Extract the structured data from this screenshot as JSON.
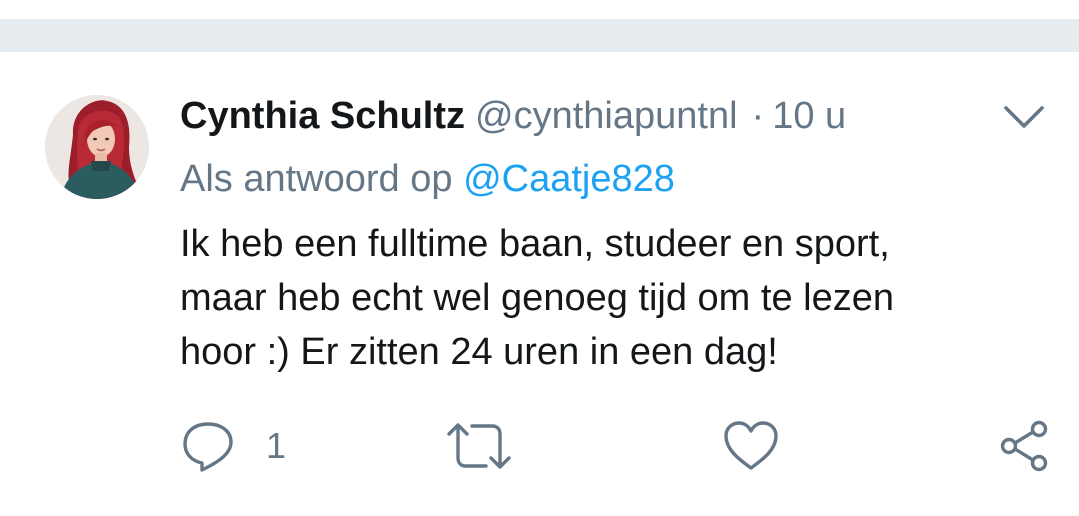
{
  "tweet": {
    "display_name": "Cynthia Schultz",
    "handle": "@cynthiapuntnl",
    "separator": "·",
    "timestamp": "10 u",
    "reply_prefix": "Als antwoord op",
    "reply_to": "@Caatje828",
    "text_lines": [
      "Ik heb een fulltime baan, studeer en sport,",
      "maar heb echt wel genoeg tijd om te lezen",
      "hoor :) Er zitten 24 uren in een dag!"
    ]
  },
  "actions": {
    "reply_count": "1",
    "icons": [
      "reply-icon",
      "retweet-icon",
      "like-icon",
      "share-icon",
      "chevron-down-icon"
    ]
  },
  "colors": {
    "primary_text": "#14171a",
    "secondary_text": "#657786",
    "link": "#1da1f2",
    "separator_band": "#e6ecf0"
  }
}
